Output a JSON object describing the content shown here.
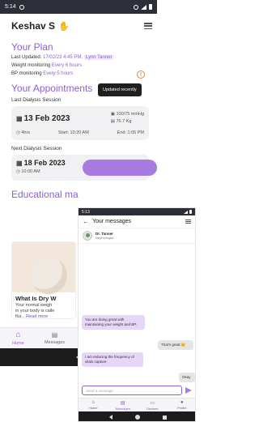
{
  "screen_a": {
    "status_time": "5:14",
    "user_name": "Keshav S",
    "plan": {
      "title": "Your Plan",
      "last_updated_label": "Last Updated:",
      "last_updated_value": "17/02/23 4:45 PM,",
      "updated_by": "Lynn Tanner",
      "weight_label": "Weight monitoring",
      "weight_value": "Every 6 hours",
      "bp_label": "BP monitoring",
      "bp_value": "Every 5 hours",
      "tooltip": "Updated recently"
    },
    "appointments": {
      "title": "Your Appointments",
      "last_label": "Last Dialysis Session",
      "last_date": "13 Feb 2023",
      "last_bp": "100/75 mmHg",
      "last_weight": "76.7 Kg",
      "last_duration": "4hrs",
      "last_start": "Start: 10:20 AM",
      "last_end": "End: 1:05 PM",
      "next_label": "Next Dialysis Session",
      "next_date": "18 Feb 2023",
      "next_time": "10:00 AM"
    },
    "education": {
      "title": "Educational ma",
      "card_title": "What Is Dry W",
      "card_text_1": "Your normal weigh",
      "card_text_2": "in your body is calle",
      "card_text_3": "flui...",
      "read_more": "Read more"
    },
    "nav": {
      "home": "Home",
      "messages": "Messages"
    }
  },
  "screen_b": {
    "status_time": "5:13",
    "title": "Your messages",
    "doctor_name": "Dr. Tanner",
    "doctor_role": "Nephrologist",
    "messages": [
      {
        "dir": "in",
        "text": "You are doing great with maintaining your weight and BP."
      },
      {
        "dir": "out",
        "text": "That's great 😊"
      },
      {
        "dir": "in",
        "text": "I am reducing the frequency of vitals capture"
      },
      {
        "dir": "out",
        "text": "Okay"
      }
    ],
    "compose_placeholder": "Send a message",
    "nav": {
      "home": "Home",
      "messages": "Messages",
      "devices": "Devices",
      "profile": "Profile"
    }
  },
  "colors": {
    "accent": "#8e5fd6",
    "accent_light": "#e7d6f7",
    "status_bar": "#2c2f38",
    "warning": "#e0893a"
  }
}
